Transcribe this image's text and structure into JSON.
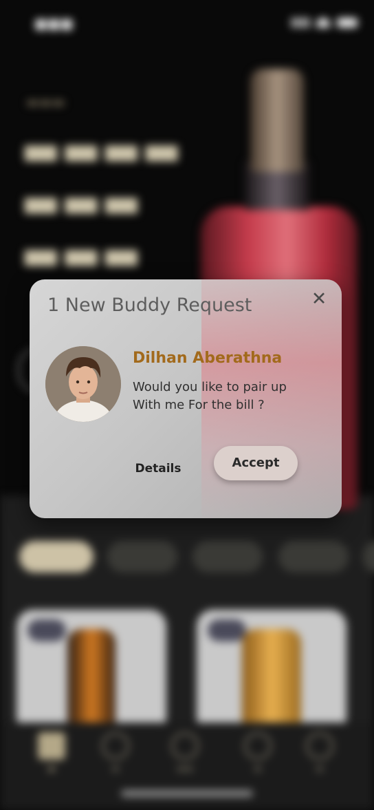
{
  "modal": {
    "title": "1 New Buddy Request",
    "close_icon": "close-icon",
    "request": {
      "name": "Dilhan Aberathna",
      "message": "Would you like to pair up With me For the bill ?"
    },
    "details_label": "Details",
    "accept_label": "Accept"
  },
  "colors": {
    "name_accent": "#a26a1c",
    "accept_button": "#dcd0cc",
    "background": "#090909"
  },
  "nav_icons": [
    "home-icon",
    "cart-icon",
    "favourites-icon",
    "chat-icon",
    "profile-icon"
  ]
}
